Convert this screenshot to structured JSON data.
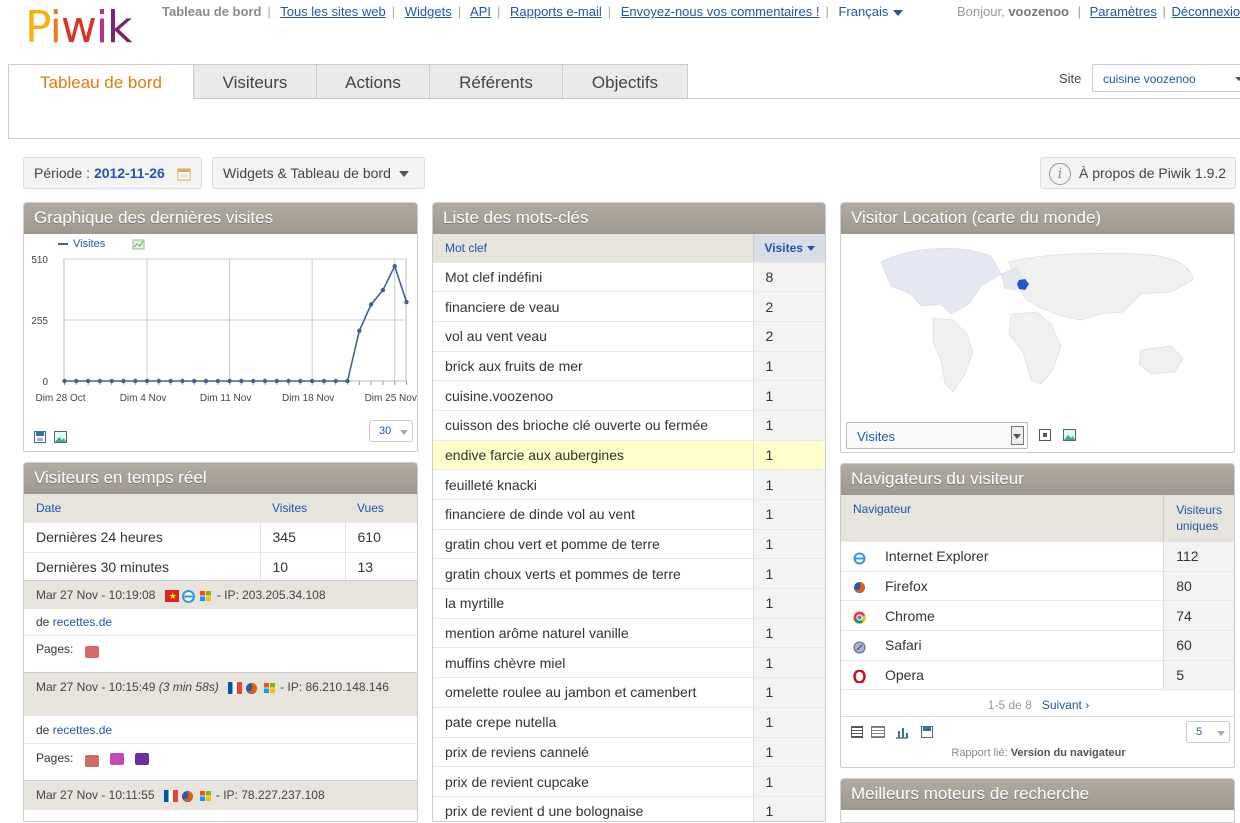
{
  "header": {
    "logo": "Piwik",
    "nav": [
      "Tableau de bord",
      "Tous les sites web",
      "Widgets",
      "API",
      "Rapports e-mail",
      "Envoyez-nous vos commentaires !",
      "Français"
    ],
    "greeting_prefix": "Bonjour,",
    "username": "voozenoo",
    "settings": "Paramètres",
    "logout": "Déconnexion"
  },
  "tabs": [
    "Tableau de bord",
    "Visiteurs",
    "Actions",
    "Référents",
    "Objectifs"
  ],
  "site": {
    "label": "Site",
    "value": "cuisine voozenoo"
  },
  "period": {
    "label": "Période :",
    "value": "2012-11-26"
  },
  "widgets_menu": "Widgets & Tableau de bord",
  "about": "À propos de Piwik 1.9.2",
  "graph_widget": {
    "title": "Graphique des dernières visites",
    "legend": "Visites",
    "limit": "30"
  },
  "chart_data": {
    "type": "line",
    "series": [
      {
        "name": "Visites",
        "values": [
          0,
          0,
          0,
          0,
          0,
          0,
          0,
          0,
          0,
          0,
          0,
          0,
          0,
          0,
          0,
          0,
          0,
          0,
          0,
          0,
          0,
          0,
          0,
          0,
          0,
          210,
          320,
          380,
          480,
          330
        ]
      }
    ],
    "x_tick_labels": [
      "Dim 28 Oct",
      "Dim 4 Nov",
      "Dim 11 Nov",
      "Dim 18 Nov",
      "Dim 25 Nov"
    ],
    "y_ticks": [
      0,
      255,
      510
    ],
    "ylim": [
      0,
      510
    ],
    "grid": true
  },
  "realtime": {
    "title": "Visiteurs en temps réel",
    "headers": [
      "Date",
      "Visites",
      "Vues"
    ],
    "rows": [
      [
        "Dernières 24 heures",
        "345",
        "610"
      ],
      [
        "Dernières 30 minutes",
        "10",
        "13"
      ]
    ],
    "visits": [
      {
        "time": "Mar 27 Nov - 10:19:08",
        "duration": "",
        "ip": "- IP: 203.205.34.108",
        "from": "de",
        "ref": "recettes.de",
        "pages": "Pages:"
      },
      {
        "time": "Mar 27 Nov - 10:15:49",
        "duration": "(3 min 58s)",
        "ip": "- IP: 86.210.148.146",
        "from": "de",
        "ref": "recettes.de",
        "pages": "Pages:"
      },
      {
        "time": "Mar 27 Nov - 10:11:55",
        "duration": "",
        "ip": "- IP: 78.227.237.108"
      }
    ]
  },
  "keywords": {
    "title": "Liste des mots-clés",
    "col1": "Mot clef",
    "col2": "Visites",
    "rows": [
      [
        "Mot clef indéfini",
        "8"
      ],
      [
        "financiere de veau",
        "2"
      ],
      [
        "vol au vent veau",
        "2"
      ],
      [
        "brick aux fruits de mer",
        "1"
      ],
      [
        "cuisine.voozenoo",
        "1"
      ],
      [
        "cuisson des brioche clé ouverte ou fermée",
        "1"
      ],
      [
        "endive farcie aux aubergines",
        "1"
      ],
      [
        "feuilleté knacki",
        "1"
      ],
      [
        "financiere de dinde vol au vent",
        "1"
      ],
      [
        "gratin chou vert et pomme de terre",
        "1"
      ],
      [
        "gratin choux verts et pommes de terre",
        "1"
      ],
      [
        "la myrtille",
        "1"
      ],
      [
        "mention arôme naturel vanille",
        "1"
      ],
      [
        "muffins chèvre miel",
        "1"
      ],
      [
        "omelette roulee au jambon et camenbert",
        "1"
      ],
      [
        "pate crepe nutella",
        "1"
      ],
      [
        "prix de reviens cannelé",
        "1"
      ],
      [
        "prix de revient cupcake",
        "1"
      ],
      [
        "prix de revient d une bolognaise",
        "1"
      ]
    ]
  },
  "map": {
    "title": "Visitor Location (carte du monde)",
    "metric": "Visites"
  },
  "browsers": {
    "title": "Navigateurs du visiteur",
    "col1": "Navigateur",
    "col2": "Visiteurs uniques",
    "rows": [
      [
        "Internet Explorer",
        "112"
      ],
      [
        "Firefox",
        "80"
      ],
      [
        "Chrome",
        "74"
      ],
      [
        "Safari",
        "60"
      ],
      [
        "Opera",
        "5"
      ]
    ],
    "pagination": "1-5 de 8",
    "next": "Suivant ›",
    "limit": "5",
    "related_label": "Rapport lié:",
    "related_value": "Version du navigateur"
  },
  "search_engines": {
    "title": "Meilleurs moteurs de recherche"
  }
}
